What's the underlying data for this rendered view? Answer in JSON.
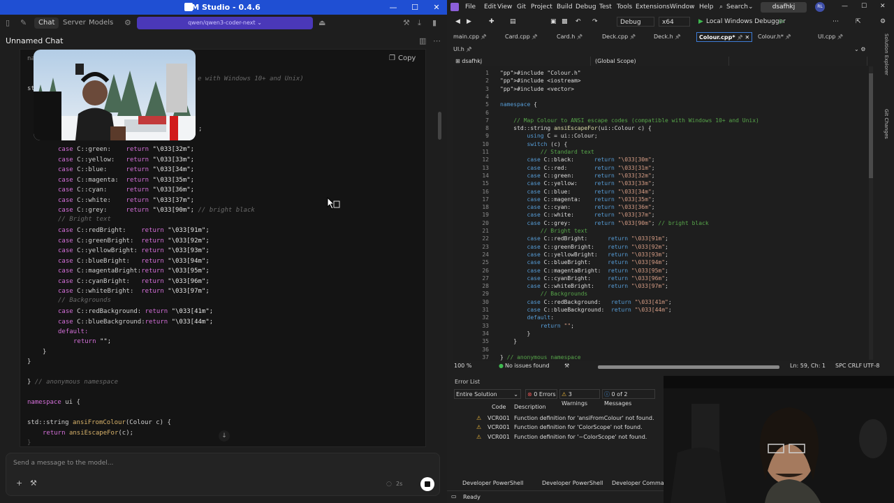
{
  "lm": {
    "title": "LM Studio - 0.4.6",
    "tabs": {
      "chat": "Chat",
      "server": "Server",
      "models": "Models"
    },
    "model": "qwen/qwen3-coder-next",
    "chat_title": "Unnamed Chat",
    "copy_label": "Copy",
    "input_placeholder": "Send a message to the model...",
    "tokens": "2s",
    "code": {
      "lead_frag": "na",
      "comment_frag": "e with Windows 10+ and Unix)",
      "std_frag": "std",
      "semi_frag": ";",
      "cases": [
        {
          "name": "C::green:",
          "val": "\"\\033[32m\";"
        },
        {
          "name": "C::yellow:",
          "val": "\"\\033[33m\";"
        },
        {
          "name": "C::blue:",
          "val": "\"\\033[34m\";"
        },
        {
          "name": "C::magenta:",
          "val": "\"\\033[35m\";"
        },
        {
          "name": "C::cyan:",
          "val": "\"\\033[36m\";"
        },
        {
          "name": "C::white:",
          "val": "\"\\033[37m\";"
        },
        {
          "name": "C::grey:",
          "val": "\"\\033[90m\";",
          "comment": "// bright black"
        }
      ],
      "bright_comment": "// Bright text",
      "bright_cases": [
        {
          "name": "C::redBright:",
          "val": "\"\\033[91m\";"
        },
        {
          "name": "C::greenBright:",
          "val": "\"\\033[92m\";"
        },
        {
          "name": "C::yellowBright:",
          "val": "\"\\033[93m\";"
        },
        {
          "name": "C::blueBright:",
          "val": "\"\\033[94m\";"
        },
        {
          "name": "C::magentaBright:",
          "val": "\"\\033[95m\";"
        },
        {
          "name": "C::cyanBright:",
          "val": "\"\\033[96m\";"
        },
        {
          "name": "C::whiteBright:",
          "val": "\"\\033[97m\";"
        }
      ],
      "bg_comment": "// Backgrounds",
      "bg_cases": [
        {
          "name": "C::redBackground:",
          "val": "\"\\033[41m\";"
        },
        {
          "name": "C::blueBackground:",
          "val": "\"\\033[44m\";"
        }
      ],
      "kw_case": "case",
      "kw_return": "return",
      "default_line": "default:",
      "return_empty": "return \"\";",
      "close_inner": "}",
      "close_outer": "}",
      "ns_close": "} // anonymous namespace",
      "ns_close_brace": "}",
      "ns_close_comment": "// anonymous namespace",
      "ns_ui_kw": "namespace",
      "ns_ui_rest": "ui {",
      "fn_sig_a": "std::string ",
      "fn_sig_name": "ansiFromColour",
      "fn_sig_b": "(Colour c) {",
      "fn_body_kw": "return",
      "fn_body_call": "ansiEscapeFor",
      "fn_body_rest": "(c);",
      "last_brace": "}"
    }
  },
  "vs": {
    "menu": [
      "File",
      "Edit",
      "View",
      "Git",
      "Project",
      "Build",
      "Debug",
      "Test",
      "Tools",
      "Extensions",
      "Window",
      "Help"
    ],
    "search": "Search",
    "solution": "dsafhkj",
    "avatar": "RL",
    "config": "Debug",
    "platform": "x64",
    "run": "Local Windows Debugger",
    "tabs": [
      "main.cpp",
      "Card.cpp",
      "Card.h",
      "Deck.cpp",
      "Deck.h",
      "Colour.cpp*",
      "Colour.h*",
      "UI.cpp",
      "UI.h"
    ],
    "nav_project": "dsafhkj",
    "nav_scope": "(Global Scope)",
    "side_tabs": [
      "Solution Explorer",
      "Git Changes"
    ],
    "lines": [
      {
        "n": "1",
        "t": "#include \"Colour.h\""
      },
      {
        "n": "2",
        "t": "#include <iostream>"
      },
      {
        "n": "3",
        "t": "#include <vector>"
      },
      {
        "n": "4",
        "t": ""
      },
      {
        "n": "5",
        "t": "namespace {"
      },
      {
        "n": "6",
        "t": ""
      },
      {
        "n": "7",
        "t": "    // Map Colour to ANSI escape codes (compatible with Windows 10+ and Unix)"
      },
      {
        "n": "8",
        "t": "    std::string ansiEscapeFor(ui::Colour c) {"
      },
      {
        "n": "9",
        "t": "        using C = ui::Colour;"
      },
      {
        "n": "10",
        "t": "        switch (c) {"
      },
      {
        "n": "11",
        "t": "            // Standard text"
      },
      {
        "n": "12",
        "t": "        case C::black:      return \"\\033[30m\";"
      },
      {
        "n": "13",
        "t": "        case C::red:        return \"\\033[31m\";"
      },
      {
        "n": "14",
        "t": "        case C::green:      return \"\\033[32m\";"
      },
      {
        "n": "15",
        "t": "        case C::yellow:     return \"\\033[33m\";"
      },
      {
        "n": "16",
        "t": "        case C::blue:       return \"\\033[34m\";"
      },
      {
        "n": "17",
        "t": "        case C::magenta:    return \"\\033[35m\";"
      },
      {
        "n": "18",
        "t": "        case C::cyan:       return \"\\033[36m\";"
      },
      {
        "n": "19",
        "t": "        case C::white:      return \"\\033[37m\";"
      },
      {
        "n": "20",
        "t": "        case C::grey:       return \"\\033[90m\"; // bright black"
      },
      {
        "n": "21",
        "t": "            // Bright text"
      },
      {
        "n": "22",
        "t": "        case C::redBright:      return \"\\033[91m\";"
      },
      {
        "n": "23",
        "t": "        case C::greenBright:    return \"\\033[92m\";"
      },
      {
        "n": "24",
        "t": "        case C::yellowBright:   return \"\\033[93m\";"
      },
      {
        "n": "25",
        "t": "        case C::blueBright:     return \"\\033[94m\";"
      },
      {
        "n": "26",
        "t": "        case C::magentaBright:  return \"\\033[95m\";"
      },
      {
        "n": "27",
        "t": "        case C::cyanBright:     return \"\\033[96m\";"
      },
      {
        "n": "28",
        "t": "        case C::whiteBright:    return \"\\033[97m\";"
      },
      {
        "n": "29",
        "t": "            // Backgrounds"
      },
      {
        "n": "30",
        "t": "        case C::redBackground:   return \"\\033[41m\";"
      },
      {
        "n": "31",
        "t": "        case C::blueBackground:  return \"\\033[44m\";"
      },
      {
        "n": "32",
        "t": "        default:"
      },
      {
        "n": "33",
        "t": "            return \"\";"
      },
      {
        "n": "34",
        "t": "        }"
      },
      {
        "n": "35",
        "t": "    }"
      },
      {
        "n": "36",
        "t": ""
      },
      {
        "n": "37",
        "t": "} // anonymous namespace"
      }
    ],
    "zoom": "100 %",
    "issues": "No issues found",
    "position": "Ln: 59, Ch: 1",
    "spc": "SPC",
    "crlf": "CRLF",
    "encoding": "UTF-8",
    "error_list_title": "Error List",
    "scope": "Entire Solution",
    "errors": "0 Errors",
    "warnings": "3 Warnings",
    "messages": "0 of 2 Messages",
    "col_code": "Code",
    "col_desc": "Description",
    "warn_rows": [
      {
        "code": "VCR001",
        "desc": "Function definition for 'ansiFromColour' not found."
      },
      {
        "code": "VCR001",
        "desc": "Function definition for 'ColorScope' not found."
      },
      {
        "code": "VCR001",
        "desc": "Function definition for '~ColorScope' not found."
      }
    ],
    "bottom_tabs": [
      "Developer PowerShell",
      "Developer PowerShell",
      "Developer Command"
    ],
    "status": "Ready"
  },
  "colors": {
    "lm_title": "#1f4fd3",
    "model_pill": "#4a38b8",
    "vs_accent": "#3d7bd5",
    "warning": "#e8b339"
  }
}
